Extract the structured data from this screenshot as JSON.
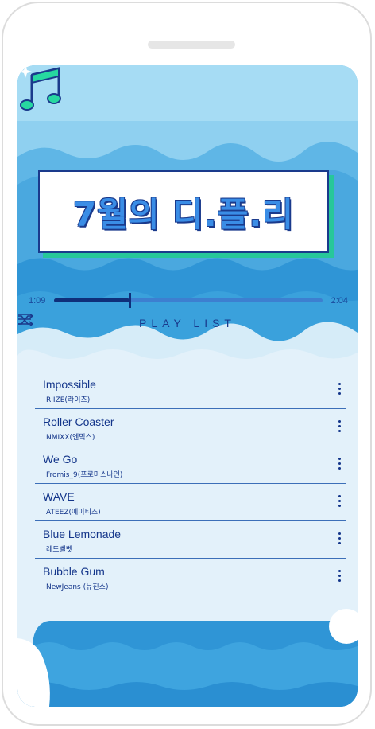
{
  "hero": {
    "title": "7월의 디.플.리",
    "note_icon": "music-note-icon"
  },
  "player": {
    "current_time": "1:09",
    "total_time": "2:04",
    "progress": 0.28
  },
  "controls": {
    "shuffle_icon": "shuffle-icon",
    "label": "PLAY LIST",
    "menu_icon": "menu-icon"
  },
  "playlist": [
    {
      "title": "Impossible",
      "artist": "RIIZE(라이즈)"
    },
    {
      "title": "Roller Coaster",
      "artist": "NMIXX(엔믹스)"
    },
    {
      "title": "We Go",
      "artist": "Fromis_9(프로미스나인)"
    },
    {
      "title": "WAVE",
      "artist": "ATEEZ(에이티즈)"
    },
    {
      "title": "Blue Lemonade",
      "artist": "레드벨벳"
    },
    {
      "title": "Bubble Gum",
      "artist": "NewJeans (뉴진스)"
    }
  ],
  "colors": {
    "accent_dark": "#13358a",
    "sea_light": "#7cc4ea",
    "sea_mid": "#45a9e0",
    "shadow_green": "#27c79a"
  }
}
